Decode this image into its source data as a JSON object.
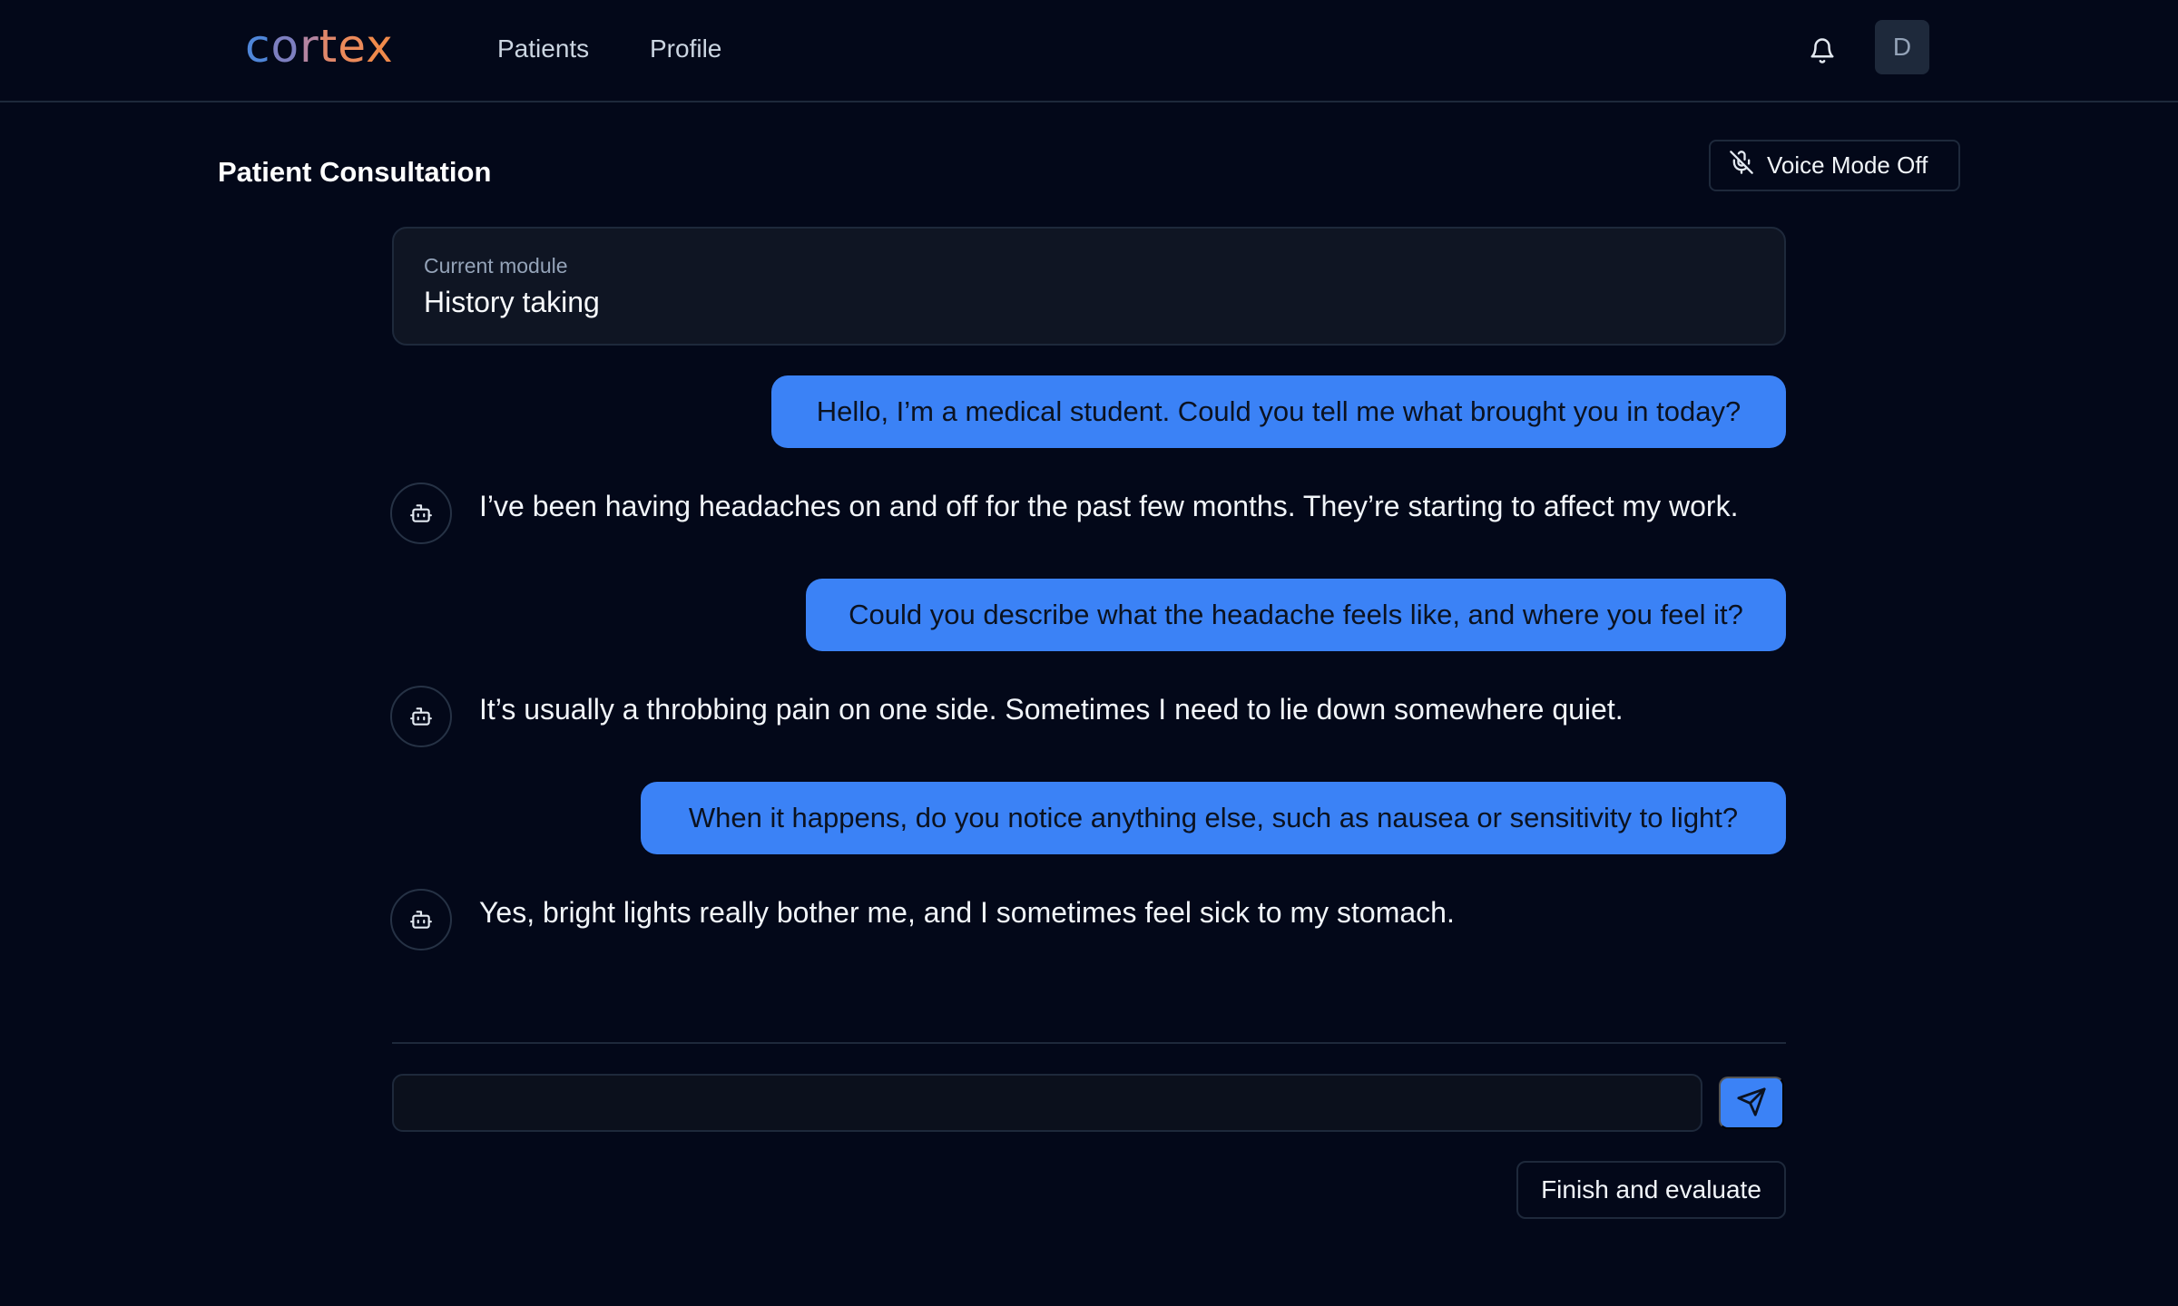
{
  "app": {
    "logo": {
      "c": "c",
      "o": "o",
      "r": "r",
      "t": "t",
      "e": "e",
      "x": "x"
    },
    "nav": [
      {
        "label": "Patients"
      },
      {
        "label": "Profile"
      }
    ],
    "avatar_initial": "D",
    "icons": {
      "notifications": "bell-icon",
      "voice": "mic-off-icon",
      "bot": "robot-icon",
      "send": "send-icon"
    }
  },
  "header": {
    "title": "Patient Consultation",
    "voice_button_label": "Voice Mode Off"
  },
  "module": {
    "label": "Current module",
    "value": "History taking"
  },
  "messages": [
    {
      "role": "user",
      "text": "Hello, I’m a medical student. Could you tell me what brought you in today?"
    },
    {
      "role": "patient",
      "text": "I’ve been having headaches on and off for the past few months. They’re starting to affect my work."
    },
    {
      "role": "user",
      "text": "Could you describe what the headache feels like, and where you feel it?"
    },
    {
      "role": "patient",
      "text": "It’s usually a throbbing pain on one side. Sometimes I need to lie down somewhere quiet."
    },
    {
      "role": "user",
      "text": "When it happens, do you notice anything else, such as nausea or sensitivity to light?"
    },
    {
      "role": "patient",
      "text": "Yes, bright lights really bother me, and I sometimes feel sick to my stomach."
    }
  ],
  "composer": {
    "value": "",
    "placeholder": ""
  },
  "finish_button_label": "Finish and evaluate",
  "colors": {
    "background": "#030819",
    "accent": "#3b82f6",
    "border": "#1e293b",
    "card": "#0f1523"
  }
}
